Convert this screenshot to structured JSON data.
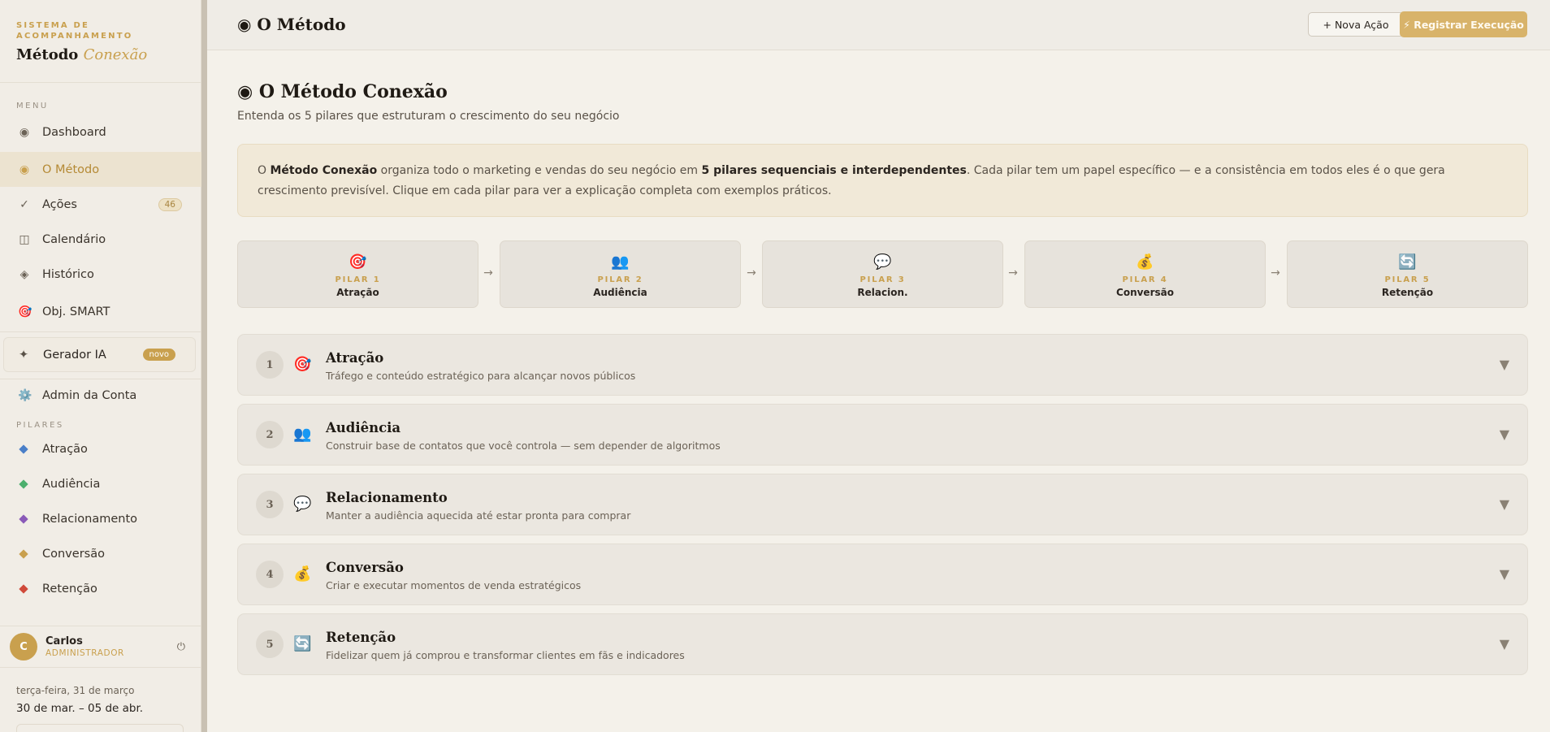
{
  "brand": {
    "subtitle": "SISTEMA DE ACOMPANHAMENTO",
    "title": "Método",
    "title_accent": "Conexão"
  },
  "sidebar": {
    "menu_label": "MENU",
    "items": [
      {
        "label": "Dashboard",
        "icon": "◉"
      },
      {
        "label": "O Método",
        "icon": "◉"
      },
      {
        "label": "Ações",
        "icon": "✓",
        "badge": "46"
      },
      {
        "label": "Calendário",
        "icon": "◫"
      },
      {
        "label": "Histórico",
        "icon": "◈"
      },
      {
        "label": "Obj. SMART",
        "icon": "🎯"
      }
    ],
    "gerador": {
      "label": "Gerador IA",
      "icon": "✦",
      "badge": "novo"
    },
    "admin": {
      "label": "Admin da Conta",
      "icon": "⚙️"
    },
    "pilares_label": "PILARES",
    "pilares": [
      {
        "label": "Atração",
        "color": "#4a7fc8"
      },
      {
        "label": "Audiência",
        "color": "#4caf6d"
      },
      {
        "label": "Relacionamento",
        "color": "#8a5ab8"
      },
      {
        "label": "Conversão",
        "color": "#c9a04e"
      },
      {
        "label": "Retenção",
        "color": "#d04a3a"
      }
    ],
    "user": {
      "initial": "C",
      "name": "Carlos",
      "role": "ADMINISTRADOR",
      "power_icon": "⏻"
    },
    "date": "terça-feira, 31 de março",
    "week": "30 de mar. – 05 de abr."
  },
  "header": {
    "title": "◉ O Método",
    "nova_acao": "+ Nova Ação",
    "registrar": "⚡ Registrar Execução"
  },
  "main": {
    "title": "◉ O Método Conexão",
    "subtitle": "Entenda os 5 pilares que estruturam o crescimento do seu negócio",
    "intro": {
      "p1": "O ",
      "b1": "Método Conexão",
      "p2": " organiza todo o marketing e vendas do seu negócio em ",
      "b2": "5 pilares sequenciais e interdependentes",
      "p3": ". Cada pilar tem um papel específico — e a consistência em todos eles é o que gera crescimento previsível. Clique em cada pilar para ver a explicação completa com exemplos práticos."
    },
    "pillar_cards": [
      {
        "emoji": "🎯",
        "num": "PILAR 1",
        "name": "Atração"
      },
      {
        "emoji": "👥",
        "num": "PILAR 2",
        "name": "Audiência"
      },
      {
        "emoji": "💬",
        "num": "PILAR 3",
        "name": "Relacion."
      },
      {
        "emoji": "💰",
        "num": "PILAR 4",
        "name": "Conversão"
      },
      {
        "emoji": "🔄",
        "num": "PILAR 5",
        "name": "Retenção"
      }
    ],
    "arrow": "→",
    "accordion": [
      {
        "num": "1",
        "emoji": "🎯",
        "title": "Atração",
        "desc": "Tráfego e conteúdo estratégico para alcançar novos públicos"
      },
      {
        "num": "2",
        "emoji": "👥",
        "title": "Audiência",
        "desc": "Construir base de contatos que você controla — sem depender de algoritmos"
      },
      {
        "num": "3",
        "emoji": "💬",
        "title": "Relacionamento",
        "desc": "Manter a audiência aquecida até estar pronta para comprar"
      },
      {
        "num": "4",
        "emoji": "💰",
        "title": "Conversão",
        "desc": "Criar e executar momentos de venda estratégicos"
      },
      {
        "num": "5",
        "emoji": "🔄",
        "title": "Retenção",
        "desc": "Fidelizar quem já comprou e transformar clientes em fãs e indicadores"
      }
    ],
    "chevron": "▼"
  }
}
